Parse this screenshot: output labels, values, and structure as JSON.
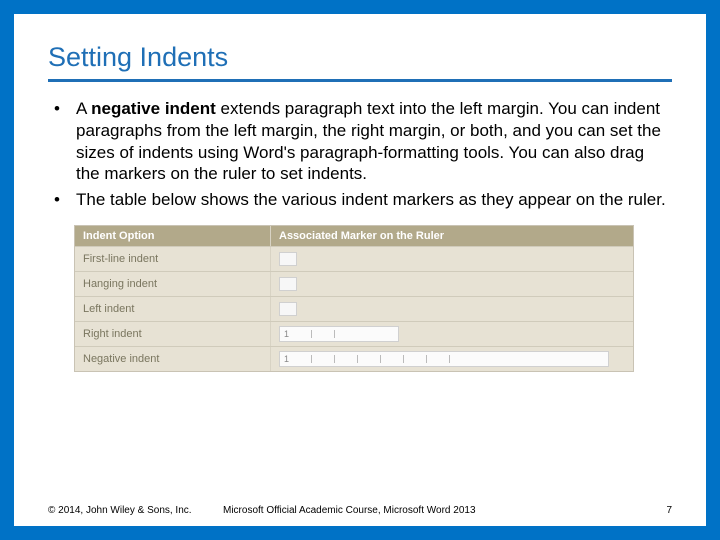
{
  "title": "Setting Indents",
  "bullets": {
    "b1": {
      "pre": "A ",
      "term": "negative indent",
      "post": " extends paragraph text into the left margin. You can indent paragraphs from the left margin, the right margin, or both, and you can set the sizes of indents using Word's paragraph-formatting tools. You can also drag the markers on the ruler to set indents."
    },
    "b2": "The table below shows the various indent markers as they appear on the ruler."
  },
  "graphic": {
    "headers": {
      "c1": "Indent Option",
      "c2": "Associated Marker on the Ruler"
    },
    "rows": {
      "r1": "First-line indent",
      "r2": "Hanging indent",
      "r3": "Left indent",
      "r4": "Right indent",
      "r5": "Negative indent"
    }
  },
  "footer": {
    "copyright": "© 2014, John Wiley & Sons, Inc.",
    "course": "Microsoft Official Academic Course, Microsoft Word 2013",
    "page": "7"
  }
}
